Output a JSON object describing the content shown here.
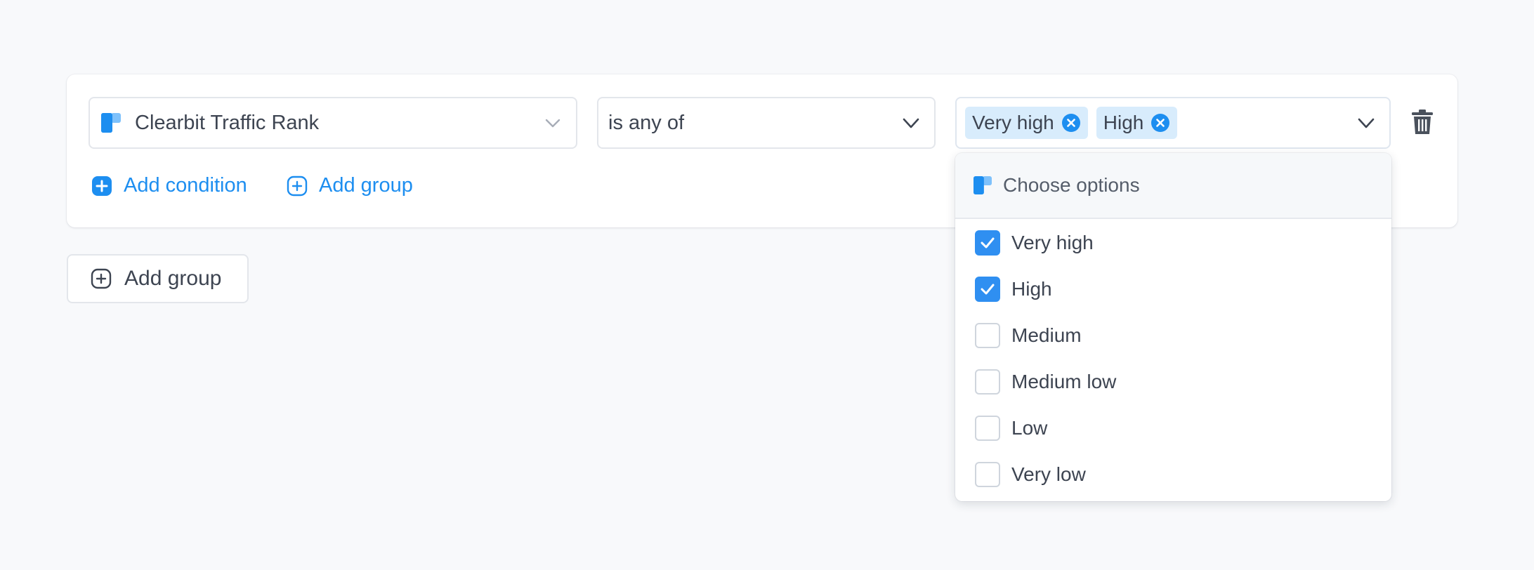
{
  "filter": {
    "field": {
      "label": "Clearbit Traffic Rank",
      "icon": "clearbit-logo-icon"
    },
    "operator": {
      "label": "is any of"
    },
    "values": {
      "tags": [
        "Very high",
        "High"
      ]
    }
  },
  "actions": {
    "add_condition": "Add condition",
    "add_group_inline": "Add group",
    "add_group": "Add group"
  },
  "dropdown": {
    "header": "Choose options",
    "options": [
      {
        "label": "Very high",
        "checked": true
      },
      {
        "label": "High",
        "checked": true
      },
      {
        "label": "Medium",
        "checked": false
      },
      {
        "label": "Medium low",
        "checked": false
      },
      {
        "label": "Low",
        "checked": false
      },
      {
        "label": "Very low",
        "checked": false
      }
    ]
  },
  "colors": {
    "accent": "#1d8ef0",
    "tag_bg": "#d8ecfc",
    "checkbox_on": "#2f8ff1"
  }
}
